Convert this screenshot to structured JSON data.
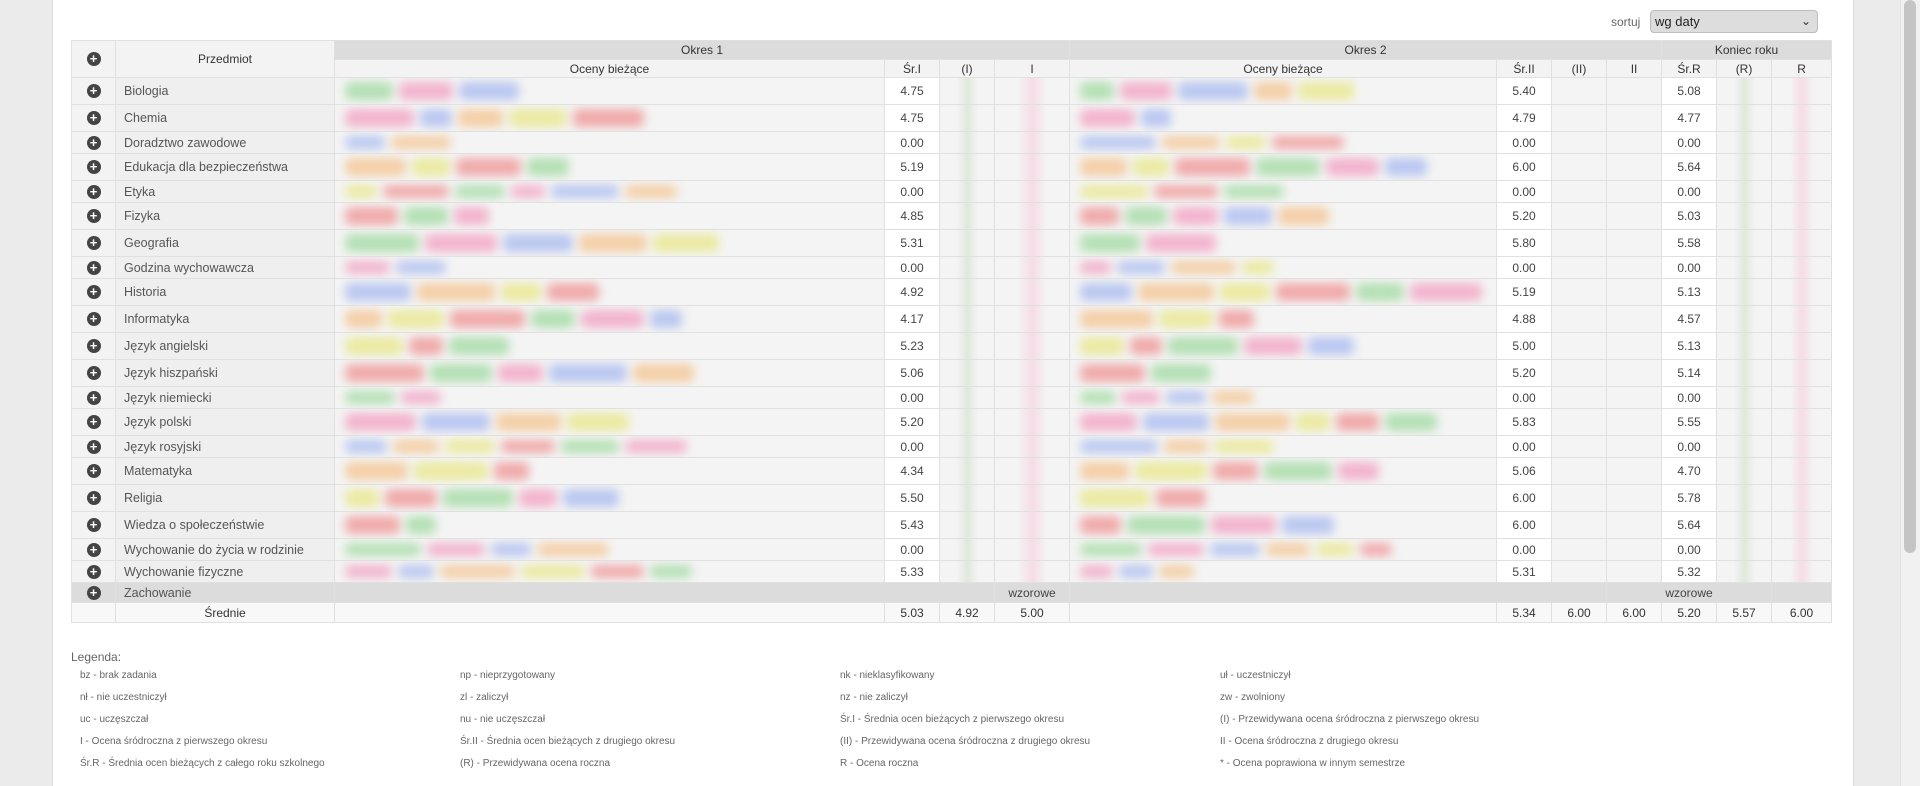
{
  "sort": {
    "label": "sortuj",
    "value": "wg daty"
  },
  "table": {
    "subject_header": "Przedmiot",
    "period1": "Okres 1",
    "period2": "Okres 2",
    "year_end": "Koniec roku",
    "grades_header": "Oceny bieżące",
    "sr1": "Śr.I",
    "pred1": "(I)",
    "final1": "I",
    "sr2": "Śr.II",
    "pred2": "(II)",
    "final2": "II",
    "srR": "Śr.R",
    "predR": "(R)",
    "finalR": "R",
    "rows": [
      {
        "name": "Biologia",
        "sr1": "4.75",
        "sr2": "5.40",
        "srR": "5.08"
      },
      {
        "name": "Chemia",
        "sr1": "4.75",
        "sr2": "4.79",
        "srR": "4.77"
      },
      {
        "name": "Doradztwo zawodowe",
        "sr1": "0.00",
        "sr2": "0.00",
        "srR": "0.00"
      },
      {
        "name": "Edukacja dla bezpieczeństwa",
        "sr1": "5.19",
        "sr2": "6.00",
        "srR": "5.64"
      },
      {
        "name": "Etyka",
        "sr1": "0.00",
        "sr2": "0.00",
        "srR": "0.00"
      },
      {
        "name": "Fizyka",
        "sr1": "4.85",
        "sr2": "5.20",
        "srR": "5.03"
      },
      {
        "name": "Geografia",
        "sr1": "5.31",
        "sr2": "5.80",
        "srR": "5.58"
      },
      {
        "name": "Godzina wychowawcza",
        "sr1": "0.00",
        "sr2": "0.00",
        "srR": "0.00"
      },
      {
        "name": "Historia",
        "sr1": "4.92",
        "sr2": "5.19",
        "srR": "5.13"
      },
      {
        "name": "Informatyka",
        "sr1": "4.17",
        "sr2": "4.88",
        "srR": "4.57"
      },
      {
        "name": "Język angielski",
        "sr1": "5.23",
        "sr2": "5.00",
        "srR": "5.13"
      },
      {
        "name": "Język hiszpański",
        "sr1": "5.06",
        "sr2": "5.20",
        "srR": "5.14"
      },
      {
        "name": "Język niemiecki",
        "sr1": "0.00",
        "sr2": "0.00",
        "srR": "0.00"
      },
      {
        "name": "Język polski",
        "sr1": "5.20",
        "sr2": "5.83",
        "srR": "5.55"
      },
      {
        "name": "Język rosyjski",
        "sr1": "0.00",
        "sr2": "0.00",
        "srR": "0.00"
      },
      {
        "name": "Matematyka",
        "sr1": "4.34",
        "sr2": "5.06",
        "srR": "4.70"
      },
      {
        "name": "Religia",
        "sr1": "5.50",
        "sr2": "6.00",
        "srR": "5.78"
      },
      {
        "name": "Wiedza o społeczeństwie",
        "sr1": "5.43",
        "sr2": "6.00",
        "srR": "5.64"
      },
      {
        "name": "Wychowanie do życia w rodzinie",
        "sr1": "0.00",
        "sr2": "0.00",
        "srR": "0.00"
      },
      {
        "name": "Wychowanie fizyczne",
        "sr1": "5.33",
        "sr2": "5.31",
        "srR": "5.32"
      }
    ],
    "behavior": {
      "name": "Zachowanie",
      "grade1": "wzorowe",
      "grade2": "wzorowe"
    },
    "means": {
      "label": "Średnie",
      "sr1": "5.03",
      "pred1": "4.92",
      "final1": "5.00",
      "sr2": "5.34",
      "pred2": "6.00",
      "final2": "6.00",
      "srR": "5.20",
      "predR": "5.57",
      "finalR": "6.00"
    }
  },
  "legend": {
    "title": "Legenda:",
    "items": [
      "bz - brak zadania",
      "np - nieprzygotowany",
      "nk - nieklasyfikowany",
      "uł - uczestniczył",
      "nł - nie uczestniczył",
      "zl - zaliczył",
      "nz - nie zaliczył",
      "zw - zwolniony",
      "uc - uczęszczał",
      "nu - nie uczęszczał",
      "Śr.I - Średnia ocen bieżących z pierwszego okresu",
      "(I) - Przewidywana ocena śródroczna z pierwszego okresu",
      "I - Ocena śródroczna z pierwszego okresu",
      "Śr.II - Średnia ocen bieżących z drugiego okresu",
      "(II) - Przewidywana ocena śródroczna z drugiego okresu",
      "II - Ocena śródroczna z drugiego okresu",
      "Śr.R - Średnia ocen bieżących z całego roku szkolnego",
      "(R) - Przewidywana ocena roczna",
      "R - Ocena roczna",
      "* - Ocena poprawiona w innym semestrze"
    ]
  },
  "colors": {
    "green": "#7fd07f",
    "pink": "#f27fae",
    "blue": "#8aa3ee",
    "orange": "#f5b167",
    "yellow": "#e4e25c",
    "red": "#ee6d6d"
  }
}
